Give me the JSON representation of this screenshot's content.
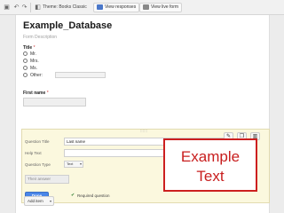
{
  "toolbar": {
    "theme_label": "Theme: Books Classic",
    "view_responses_label": "View responses",
    "view_live_label": "View live form"
  },
  "form": {
    "title": "Example_Database",
    "description": "Form Description",
    "questions": {
      "title": {
        "label": "Title",
        "required_mark": "*",
        "options": [
          "Mr.",
          "Mrs.",
          "Ms.",
          "Other:"
        ]
      },
      "first_name": {
        "label": "First name",
        "required_mark": "*"
      }
    }
  },
  "edit_panel": {
    "question_title_label": "Question Title",
    "question_title_value": "Last name",
    "help_text_label": "Help Text",
    "question_type_label": "Question Type",
    "question_type_value": "Text",
    "answer_placeholder": "Their answer",
    "done_label": "Done",
    "required_label": "Required question",
    "required_checked": true,
    "drag_handle": "::::::"
  },
  "callout": {
    "text": "Example\nText",
    "color": "#cc1f1f"
  },
  "add_item": {
    "label": "Add item"
  },
  "colors": {
    "accent": "#4a86e8",
    "edit_panel_bg": "#fbf8de"
  }
}
